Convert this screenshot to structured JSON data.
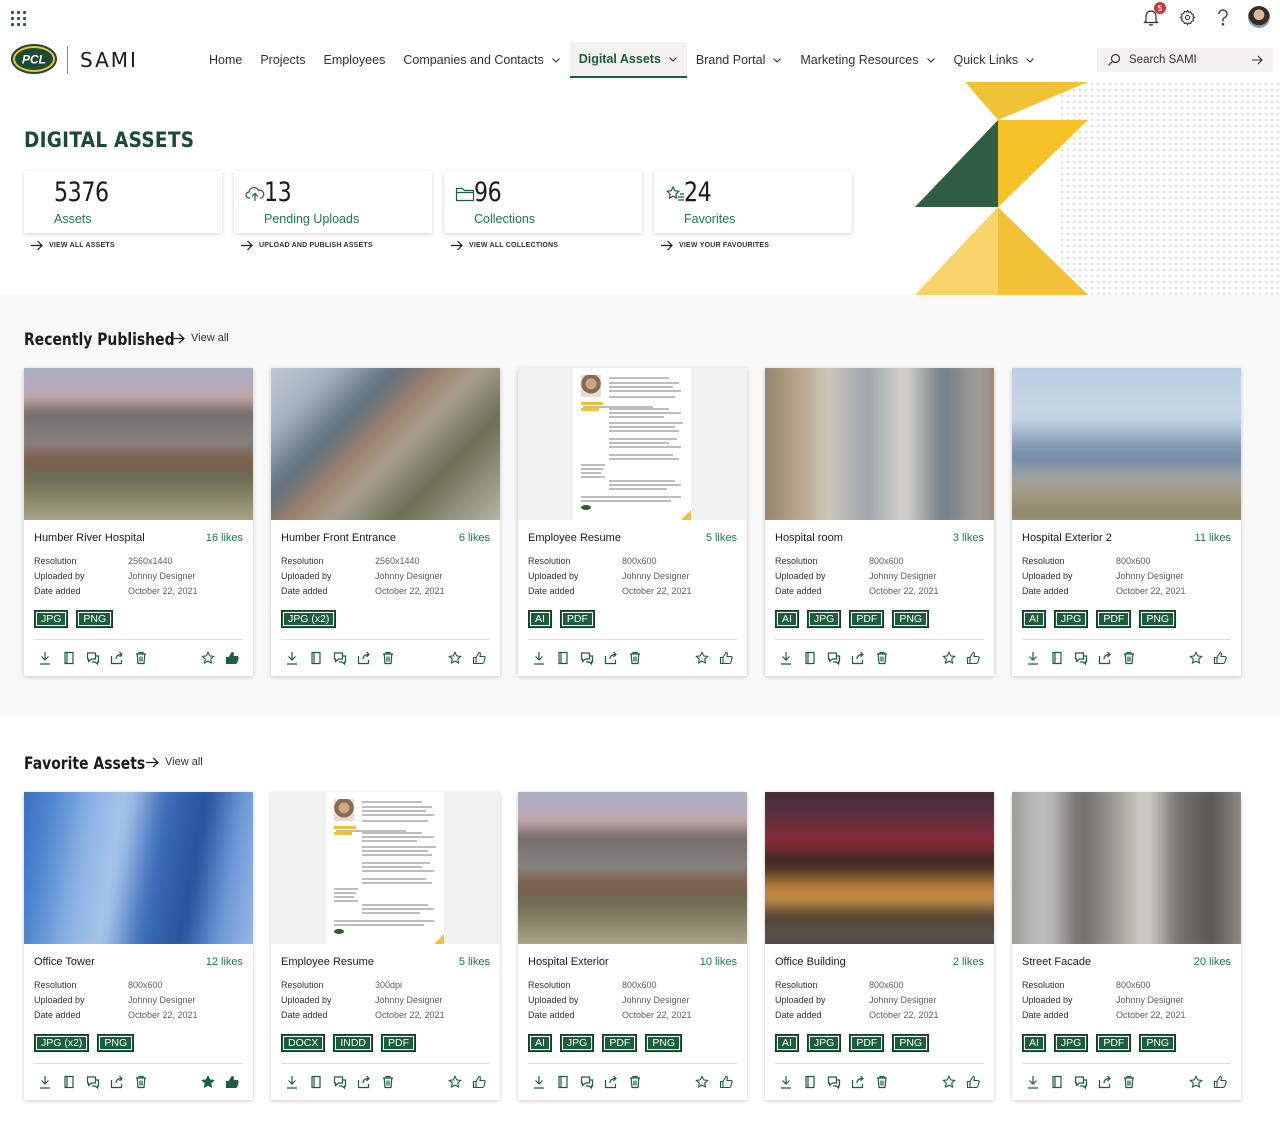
{
  "app": {
    "brand_name": "SAMI",
    "logo_text": "PCL",
    "notification_count": "5"
  },
  "nav": {
    "items": [
      {
        "label": "Home",
        "dropdown": false,
        "active": false
      },
      {
        "label": "Projects",
        "dropdown": false,
        "active": false
      },
      {
        "label": "Employees",
        "dropdown": false,
        "active": false
      },
      {
        "label": "Companies and Contacts",
        "dropdown": true,
        "active": false
      },
      {
        "label": "Digital Assets",
        "dropdown": true,
        "active": true
      },
      {
        "label": "Brand Portal",
        "dropdown": true,
        "active": false
      },
      {
        "label": "Marketing Resources",
        "dropdown": true,
        "active": false
      },
      {
        "label": "Quick Links",
        "dropdown": true,
        "active": false
      }
    ],
    "search_placeholder": "Search SAMI"
  },
  "hero": {
    "title": "DIGITAL ASSETS",
    "stats": [
      {
        "value": "5376",
        "label": "Assets",
        "link": "VIEW ALL ASSETS",
        "icon": "none"
      },
      {
        "value": "13",
        "label": "Pending Uploads",
        "link": "UPLOAD AND PUBLISH ASSETS",
        "icon": "cloud-upload-icon"
      },
      {
        "value": "96",
        "label": "Collections",
        "link": "VIEW ALL COLLECTIONS",
        "icon": "folder-icon"
      },
      {
        "value": "24",
        "label": "Favorites",
        "link": "VIEW YOUR FAVOURITES",
        "icon": "star-list-icon"
      }
    ]
  },
  "colors": {
    "brand_green": "#1b5e3b",
    "accent_green": "#1b7a4b",
    "brand_yellow": "#f2c236",
    "notification_red": "#d13438"
  },
  "meta_labels": {
    "resolution": "Resolution",
    "uploaded_by": "Uploaded by",
    "date_added": "Date added"
  },
  "recently_published": {
    "title": "Recently Published",
    "view_all": "View all",
    "cards": [
      {
        "title": "Humber River Hospital",
        "likes": "16 likes",
        "resolution": "2560x1440",
        "uploaded_by": "Johnny Designer",
        "date_added": "October 22, 2021",
        "tags": [
          "JPG",
          "PNG"
        ],
        "thumb": "hospital-a",
        "favorited": false,
        "liked": true
      },
      {
        "title": "Humber Front Entrance",
        "likes": "6 likes",
        "resolution": "2560x1440",
        "uploaded_by": "Johnny Designer",
        "date_added": "October 22, 2021",
        "tags": [
          "JPG (x2)"
        ],
        "thumb": "entrance",
        "favorited": false,
        "liked": false
      },
      {
        "title": "Employee Resume",
        "likes": "5 likes",
        "resolution": "800x600",
        "uploaded_by": "Johnny Designer",
        "date_added": "October 22, 2021",
        "tags": [
          "AI",
          "PDF"
        ],
        "thumb": "resume",
        "favorited": false,
        "liked": false
      },
      {
        "title": "Hospital room",
        "likes": "3 likes",
        "resolution": "800x600",
        "uploaded_by": "Johnny Designer",
        "date_added": "October 22, 2021",
        "tags": [
          "AI",
          "JPG",
          "PDF",
          "PNG"
        ],
        "thumb": "room",
        "favorited": false,
        "liked": false
      },
      {
        "title": "Hospital Exterior 2",
        "likes": "11 likes",
        "resolution": "800x600",
        "uploaded_by": "Johnny Designer",
        "date_added": "October 22, 2021",
        "tags": [
          "AI",
          "JPG",
          "PDF",
          "PNG"
        ],
        "thumb": "exterior2",
        "favorited": false,
        "liked": false
      }
    ]
  },
  "favorite_assets": {
    "title": "Favorite Assets",
    "view_all": "View all",
    "cards": [
      {
        "title": "Office Tower",
        "likes": "12 likes",
        "resolution": "800x600",
        "uploaded_by": "Johnny Designer",
        "date_added": "October 22, 2021",
        "tags": [
          "JPG (x2)",
          "PNG"
        ],
        "thumb": "tower",
        "favorited": true,
        "liked": true
      },
      {
        "title": "Employee Resume",
        "likes": "5 likes",
        "resolution": "300dpi",
        "uploaded_by": "Johnny Designer",
        "date_added": "October 22, 2021",
        "tags": [
          "DOCX",
          "INDD",
          "PDF"
        ],
        "thumb": "resume",
        "favorited": false,
        "liked": false
      },
      {
        "title": "Hospital Exterior",
        "likes": "10 likes",
        "resolution": "800x600",
        "uploaded_by": "Johnny Designer",
        "date_added": "October 22, 2021",
        "tags": [
          "AI",
          "JPG",
          "PDF",
          "PNG"
        ],
        "thumb": "hospital-a",
        "favorited": false,
        "liked": false
      },
      {
        "title": "Office Building",
        "likes": "2 likes",
        "resolution": "800x600",
        "uploaded_by": "Johnny Designer",
        "date_added": "October 22, 2021",
        "tags": [
          "AI",
          "JPG",
          "PDF",
          "PNG"
        ],
        "thumb": "night",
        "favorited": false,
        "liked": false
      },
      {
        "title": "Street Facade",
        "likes": "20 likes",
        "resolution": "800x600",
        "uploaded_by": "Johnny Designer",
        "date_added": "October 22, 2021",
        "tags": [
          "AI",
          "JPG",
          "PDF",
          "PNG"
        ],
        "thumb": "street",
        "favorited": false,
        "liked": false
      }
    ]
  }
}
